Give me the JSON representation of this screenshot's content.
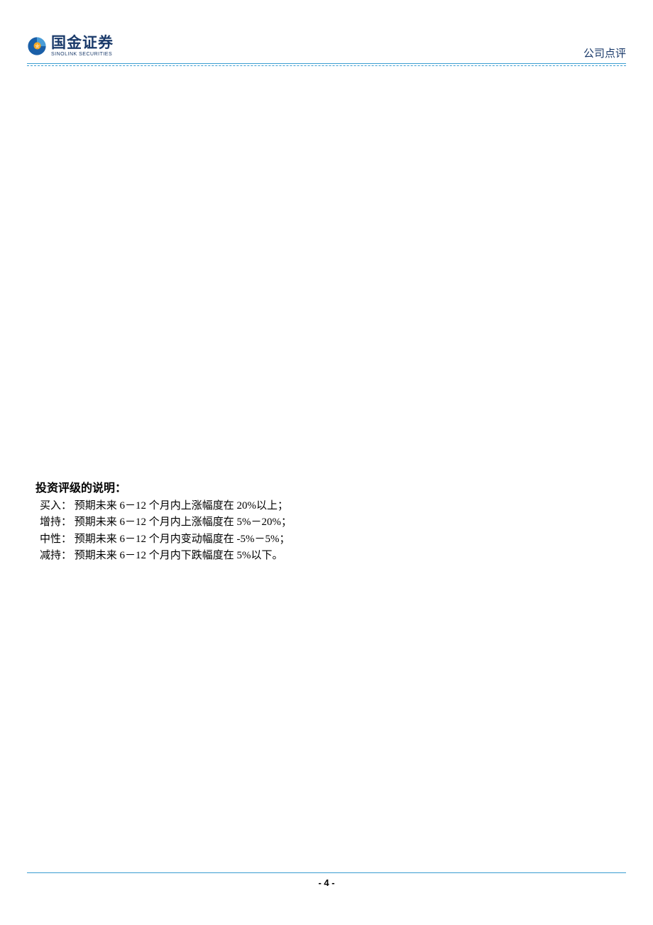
{
  "header": {
    "logo_cn": "国金证券",
    "logo_en": "SINOLINK SECURITIES",
    "doc_type": "公司点评"
  },
  "content": {
    "section_title": "投资评级的说明：",
    "ratings": [
      {
        "label": "买入：",
        "desc": "预期未来 6－12 个月内上涨幅度在 20%以上；"
      },
      {
        "label": "增持：",
        "desc": "预期未来 6－12 个月内上涨幅度在 5%－20%；"
      },
      {
        "label": "中性：",
        "desc": "预期未来 6－12 个月内变动幅度在 -5%－5%；"
      },
      {
        "label": "减持：",
        "desc": "预期未来 6－12 个月内下跌幅度在 5%以下。"
      }
    ]
  },
  "footer": {
    "page_number": "- 4 -"
  }
}
